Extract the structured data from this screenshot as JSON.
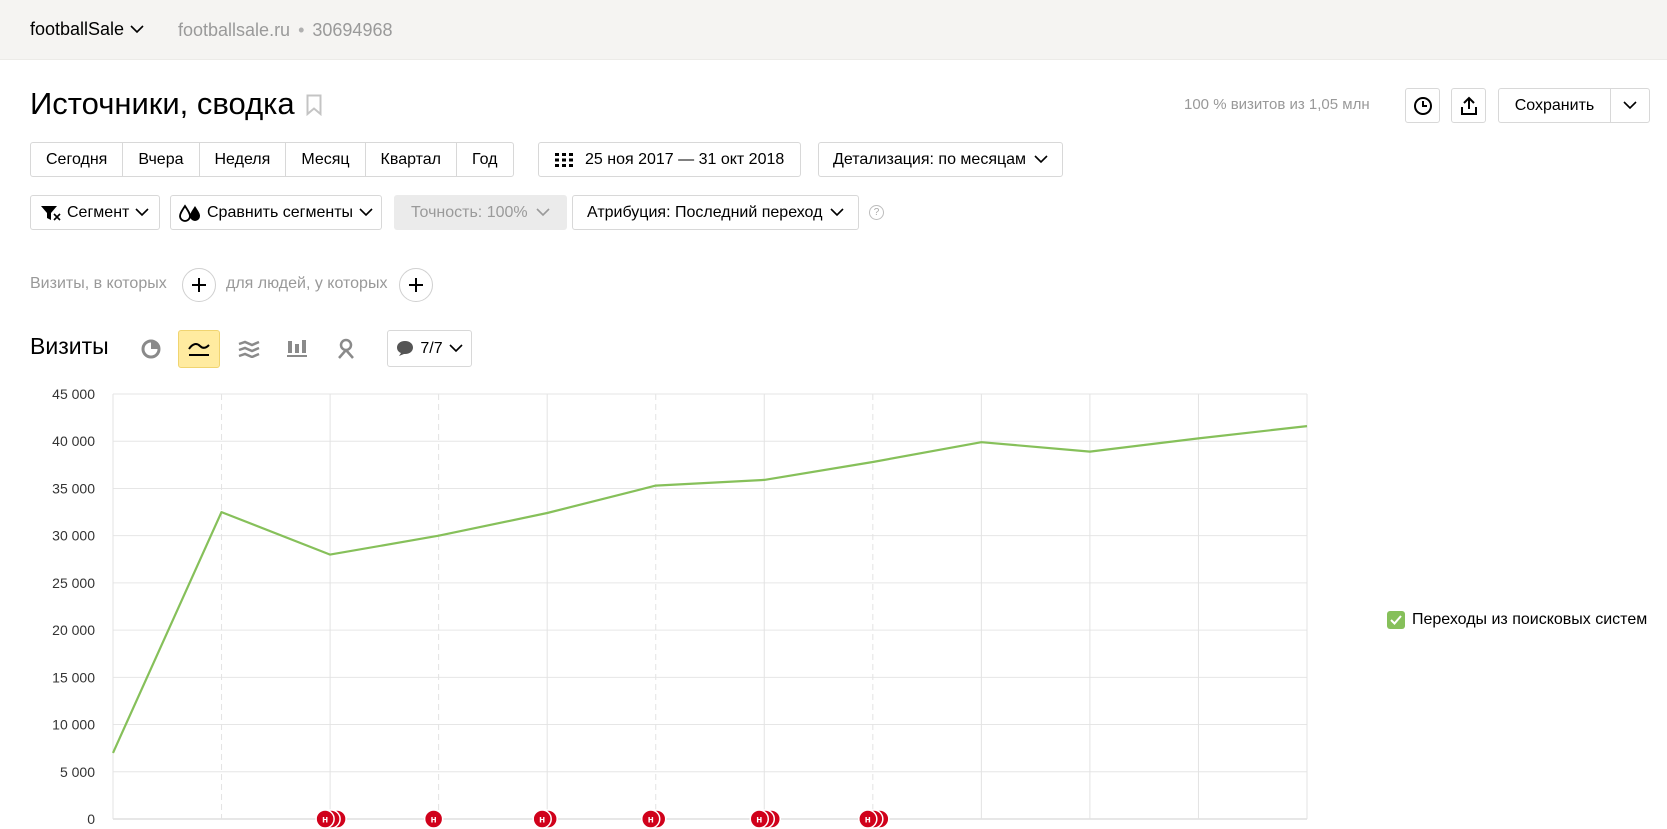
{
  "header": {
    "counter_name": "footballSale",
    "site": "footballsale.ru",
    "separator": "•",
    "counter_id": "30694968"
  },
  "title": "Источники, сводка",
  "visits_share": "100 % визитов из 1,05 млн",
  "save_label": "Сохранить",
  "periods": [
    "Сегодня",
    "Вчера",
    "Неделя",
    "Месяц",
    "Квартал",
    "Год"
  ],
  "date_range": "25 ноя 2017 — 31 окт 2018",
  "detail": "Детализация: по месяцам",
  "segment": "Сегмент",
  "compare": "Сравнить сегменты",
  "accuracy": "Точность: 100%",
  "attribution": "Атрибуция: Последний переход",
  "help": "?",
  "filter": {
    "visits_text": "Визиты, в которых",
    "people_text": "для людей, у которых"
  },
  "chart_section": {
    "title": "Визиты",
    "notes_count": "7/7",
    "chart_types": [
      "pie-chart-icon",
      "line-chart-icon",
      "area-chart-icon",
      "bar-chart-icon",
      "map-icon"
    ],
    "active_type": "line-chart-icon"
  },
  "legend": {
    "label": "Переходы из поисковых систем",
    "color": "#86c05a",
    "checked": true
  },
  "chart_data": {
    "type": "line",
    "ylim": [
      0,
      45000
    ],
    "yticks": [
      "0",
      "5 000",
      "10 000",
      "15 000",
      "20 000",
      "25 000",
      "30 000",
      "35 000",
      "40 000",
      "45 000"
    ],
    "series": [
      {
        "name": "Переходы из поисковых систем",
        "color": "#86c05a",
        "values": [
          7000,
          32500,
          28000,
          30000,
          32400,
          35300,
          35900,
          37800,
          39900,
          38900,
          40300,
          41600
        ]
      }
    ],
    "annotations": [
      {
        "index": 2,
        "label": "н",
        "count": 3
      },
      {
        "index": 3,
        "label": "н",
        "count": 1
      },
      {
        "index": 4,
        "label": "н",
        "count": 2
      },
      {
        "index": 5,
        "label": "н",
        "count": 2
      },
      {
        "index": 6,
        "label": "н",
        "count": 3
      },
      {
        "index": 7,
        "label": "н",
        "count": 3
      }
    ],
    "grid": true
  }
}
